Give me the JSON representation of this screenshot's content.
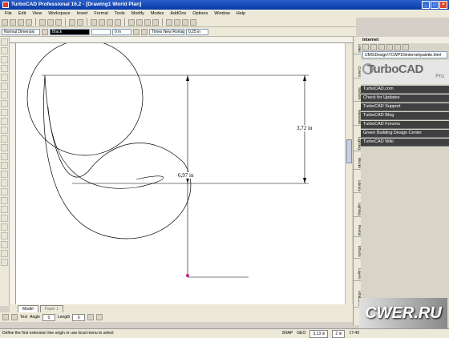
{
  "window": {
    "title": "TurboCAD Professional 16.2 - [Drawing1 World Plan]"
  },
  "menu": [
    "File",
    "Edit",
    "View",
    "Workspace",
    "Insert",
    "Format",
    "Tools",
    "Modify",
    "Modes",
    "AddOns",
    "Options",
    "Window",
    "Help"
  ],
  "toolbar2": {
    "dim_style": "Normal Dimensio",
    "pen_color": "Black",
    "width": "0 in",
    "font": "Times New Roman",
    "font_size": "0,25 in"
  },
  "drawing": {
    "dim_vertical": "3,72 in",
    "dim_horizontal": "6,97 in"
  },
  "tabs": {
    "model": "Model",
    "paper": "Paper 1"
  },
  "inspector": {
    "text": "Text",
    "angle": "Angle",
    "length": "Length",
    "angle_value": "0",
    "length_value": "0"
  },
  "status": {
    "prompt": "Define the first extension line origin or use local menu to select",
    "snap": "SNAP",
    "geo": "GEO",
    "coord": "3,13 in",
    "coord2": "2 in",
    "time": "17:40"
  },
  "panel": {
    "title": "Internet",
    "url": "UMS\\Design\\TCWP16\\internet\\palette.html",
    "logo": "TurboCAD",
    "logo_sub": "Pro",
    "links": [
      "TurboCAD.com",
      "Check for Updates",
      "TurboCAD Support",
      "TurboCAD Blog",
      "TurboCAD Forums",
      "Green Building Design Center",
      "TurboCAD Wiki"
    ]
  },
  "sidetabs": [
    "Links",
    "Colors",
    "Surface",
    "Materials",
    "Lighting",
    "Blocks",
    "Library",
    "Lighting",
    "Rental",
    "Effects",
    "Layers",
    "Attributes"
  ],
  "watermark": "CWER.RU"
}
